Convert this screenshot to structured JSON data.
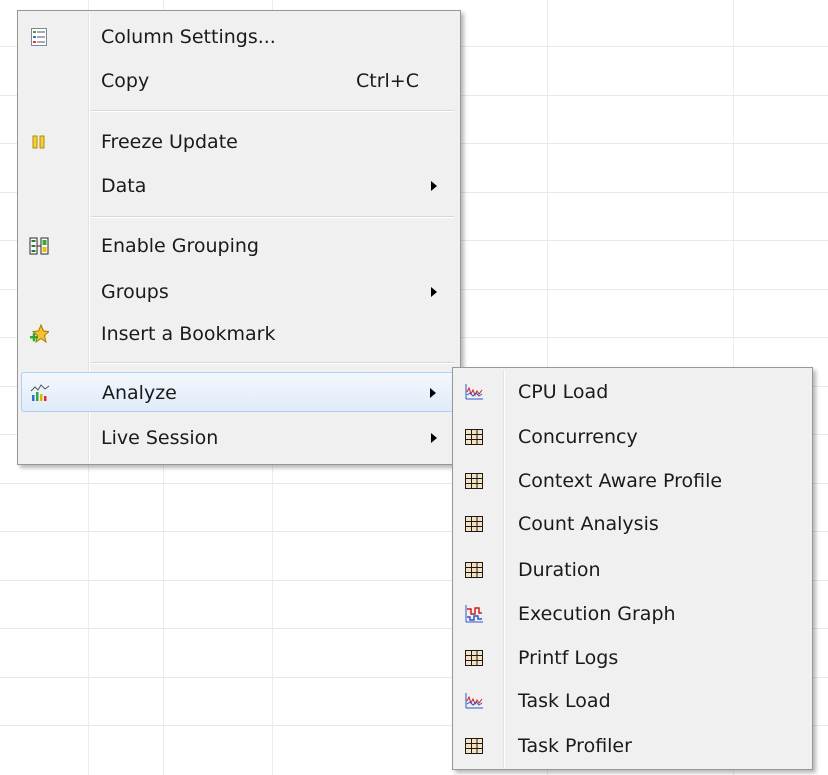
{
  "context_menu": {
    "items": [
      {
        "label": "Column Settings...",
        "icon": "column-settings-icon"
      },
      {
        "label": "Copy",
        "shortcut": "Ctrl+C"
      },
      {
        "label": "Freeze Update",
        "icon": "pause-icon"
      },
      {
        "label": "Data",
        "submenu": true
      },
      {
        "label": "Enable Grouping",
        "icon": "grouping-icon"
      },
      {
        "label": "Groups",
        "submenu": true
      },
      {
        "label": "Insert a Bookmark",
        "icon": "bookmark-star-icon"
      },
      {
        "label": "Analyze",
        "icon": "analyze-chart-icon",
        "submenu": true,
        "highlighted": true
      },
      {
        "label": "Live Session",
        "submenu": true
      }
    ]
  },
  "analyze_submenu": {
    "items": [
      {
        "label": "CPU Load",
        "icon": "line-chart-icon"
      },
      {
        "label": "Concurrency",
        "icon": "table-grid-icon"
      },
      {
        "label": "Context Aware Profile",
        "icon": "table-grid-icon"
      },
      {
        "label": "Count Analysis",
        "icon": "table-grid-icon"
      },
      {
        "label": "Duration",
        "icon": "table-grid-icon"
      },
      {
        "label": "Execution Graph",
        "icon": "execution-graph-icon"
      },
      {
        "label": "Printf Logs",
        "icon": "table-grid-icon"
      },
      {
        "label": "Task Load",
        "icon": "line-chart-icon"
      },
      {
        "label": "Task Profiler",
        "icon": "table-grid-icon"
      }
    ]
  },
  "colors": {
    "menu_bg": "#f0f0f0",
    "menu_border": "#979797",
    "highlight_border": "#aecff7",
    "grid_icon": "#b85c00"
  }
}
